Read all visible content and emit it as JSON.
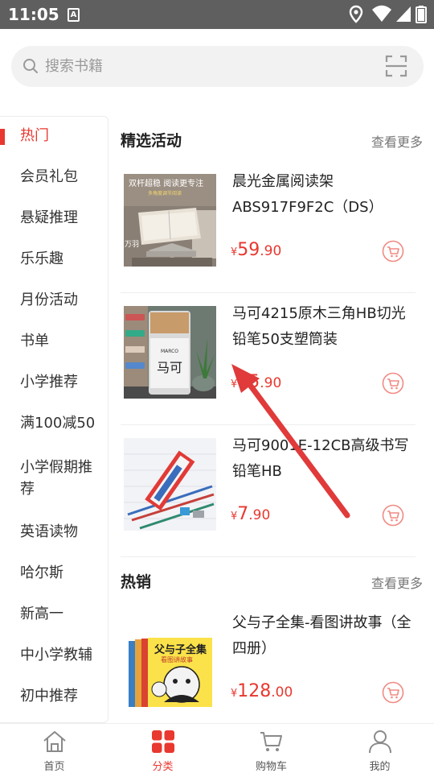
{
  "status_bar": {
    "time": "11:05",
    "notification_icon": "A",
    "icons": [
      "location-icon",
      "wifi-icon",
      "signal-icon",
      "battery-icon"
    ]
  },
  "search": {
    "placeholder": "搜索书籍",
    "icon": "search-icon",
    "scan_icon": "scan-icon"
  },
  "sidebar": {
    "items": [
      {
        "label": "热门",
        "active": true
      },
      {
        "label": "会员礼包",
        "active": false
      },
      {
        "label": "悬疑推理",
        "active": false
      },
      {
        "label": "乐乐趣",
        "active": false
      },
      {
        "label": "月份活动",
        "active": false
      },
      {
        "label": "书单",
        "active": false
      },
      {
        "label": "小学推荐",
        "active": false
      },
      {
        "label": "满100减50",
        "active": false
      },
      {
        "label": "小学假期推荐",
        "active": false
      },
      {
        "label": "英语读物",
        "active": false
      },
      {
        "label": "哈尔斯",
        "active": false
      },
      {
        "label": "新高一",
        "active": false
      },
      {
        "label": "中小学教辅",
        "active": false
      },
      {
        "label": "初中推荐",
        "active": false
      }
    ]
  },
  "sections": [
    {
      "title": "精选活动",
      "more": "查看更多",
      "products": [
        {
          "name": "晨光金属阅读架ABS917F9F2C（DS）",
          "currency": "¥",
          "price_int": "59",
          "price_dec": ".90",
          "thumb_text": "双杆超稳 阅读更专注",
          "thumb_sub": "多角度调节阅读",
          "thumb_brand": "万羽"
        },
        {
          "name": "马可4215原木三角HB切光铅笔50支塑筒装",
          "currency": "¥",
          "price_int": "15",
          "price_dec": ".90",
          "thumb_text": "",
          "thumb_sub": "",
          "thumb_brand": ""
        },
        {
          "name": "马可9001E-12CB高级书写铅笔HB",
          "currency": "¥",
          "price_int": "7",
          "price_dec": ".90",
          "thumb_text": "",
          "thumb_sub": "",
          "thumb_brand": ""
        }
      ]
    },
    {
      "title": "热销",
      "more": "查看更多",
      "products": [
        {
          "name": "父与子全集-看图讲故事（全四册）",
          "currency": "¥",
          "price_int": "128",
          "price_dec": ".00",
          "thumb_text": "父与子全集",
          "thumb_sub": "看图讲故事",
          "thumb_brand": ""
        }
      ]
    }
  ],
  "bottom_nav": [
    {
      "label": "首页",
      "icon": "home-icon",
      "active": false
    },
    {
      "label": "分类",
      "icon": "category-icon",
      "active": true
    },
    {
      "label": "购物车",
      "icon": "cart-icon",
      "active": false
    },
    {
      "label": "我的",
      "icon": "profile-icon",
      "active": false
    }
  ],
  "colors": {
    "accent": "#e8382f",
    "status_bar": "#5f5f5f",
    "search_bg": "#f2f2f2",
    "annotation_arrow": "#e03a3a"
  }
}
